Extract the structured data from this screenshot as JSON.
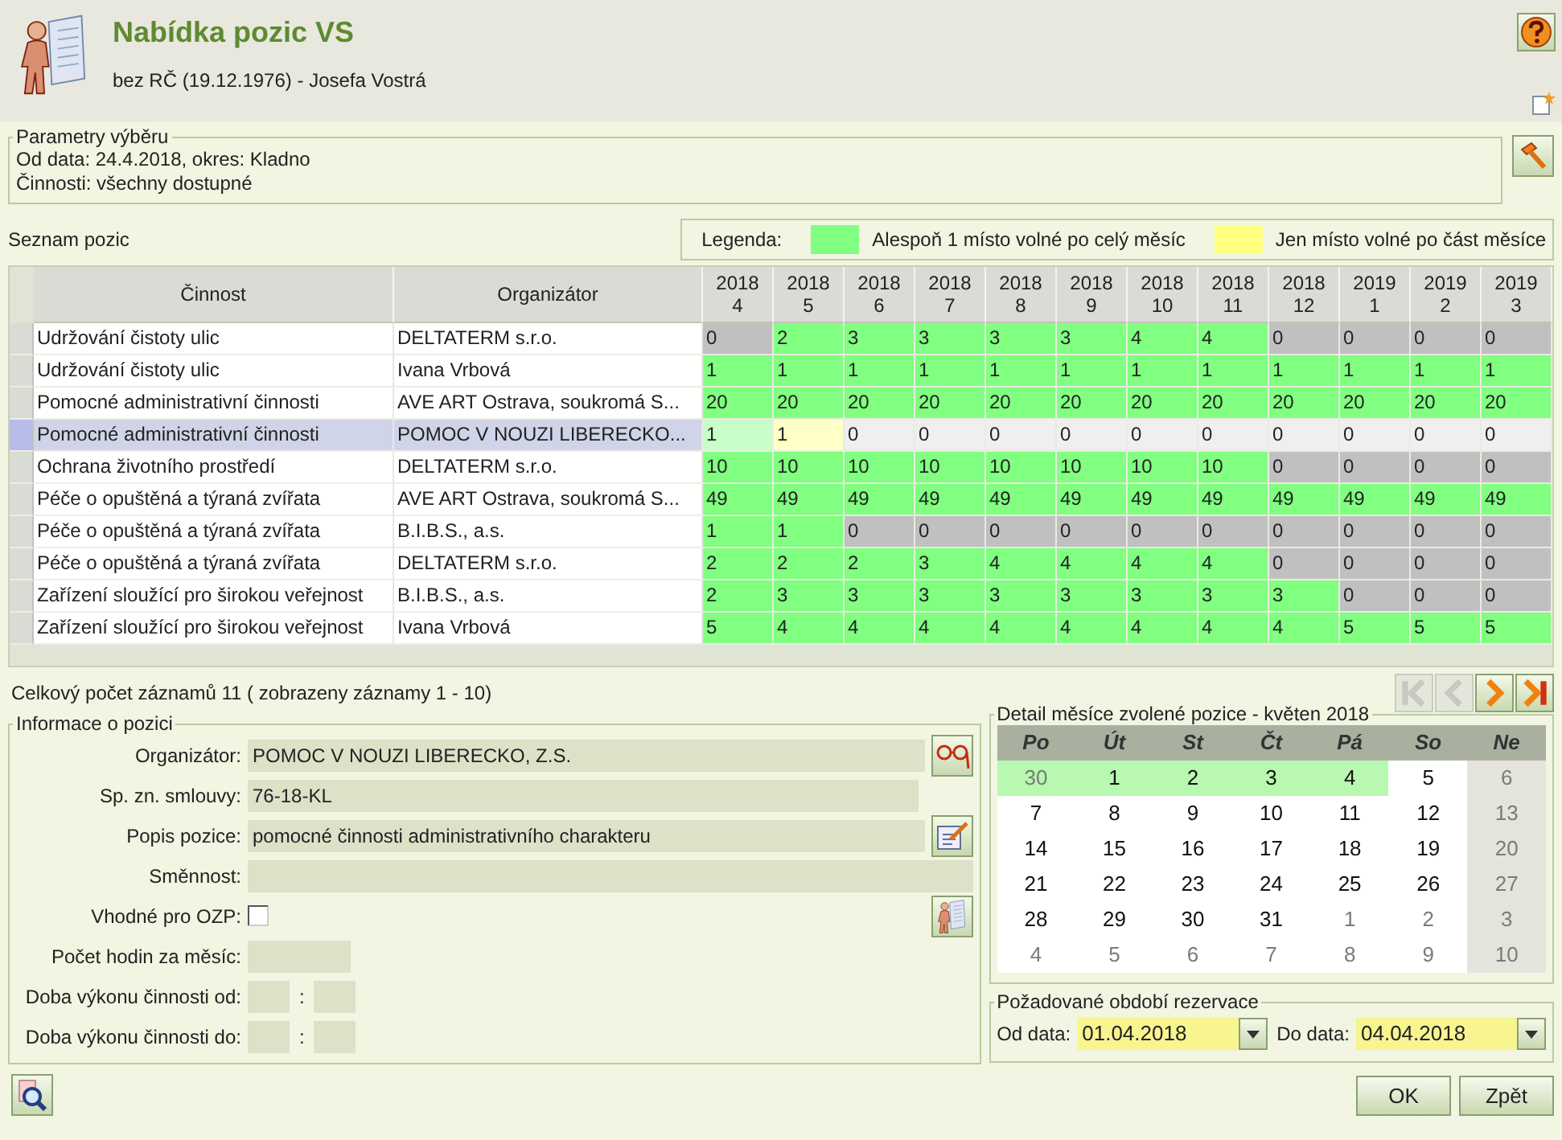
{
  "header": {
    "title": "Nabídka pozic VS",
    "subtitle": "bez RČ (19.12.1976) - Josefa Vostrá"
  },
  "parameters": {
    "legend": "Parametry výběru",
    "lines": [
      "Od data: 24.4.2018, okres: Kladno",
      "Činnosti: všechny dostupné"
    ]
  },
  "list_title": "Seznam pozic",
  "legend": {
    "label": "Legenda:",
    "items": [
      {
        "label": "Alespoň 1 místo volné po celý měsíc",
        "color": "#80ff80"
      },
      {
        "label": "Jen místo volné po část měsíce",
        "color": "#ffff80"
      }
    ]
  },
  "table": {
    "columns": [
      "Činnost",
      "Organizátor"
    ],
    "months": [
      [
        "2018",
        "4"
      ],
      [
        "2018",
        "5"
      ],
      [
        "2018",
        "6"
      ],
      [
        "2018",
        "7"
      ],
      [
        "2018",
        "8"
      ],
      [
        "2018",
        "9"
      ],
      [
        "2018",
        "10"
      ],
      [
        "2018",
        "11"
      ],
      [
        "2018",
        "12"
      ],
      [
        "2019",
        "1"
      ],
      [
        "2019",
        "2"
      ],
      [
        "2019",
        "3"
      ]
    ],
    "rows": [
      {
        "activity": "Udržování čistoty ulic",
        "organizer": "DELTATERM s.r.o.",
        "selected": false,
        "cells": [
          {
            "value": "0",
            "kind": "none"
          },
          {
            "value": "2",
            "kind": "full"
          },
          {
            "value": "3",
            "kind": "full"
          },
          {
            "value": "3",
            "kind": "full"
          },
          {
            "value": "3",
            "kind": "full"
          },
          {
            "value": "3",
            "kind": "full"
          },
          {
            "value": "4",
            "kind": "full"
          },
          {
            "value": "4",
            "kind": "full"
          },
          {
            "value": "0",
            "kind": "none"
          },
          {
            "value": "0",
            "kind": "none"
          },
          {
            "value": "0",
            "kind": "none"
          },
          {
            "value": "0",
            "kind": "none"
          }
        ]
      },
      {
        "activity": "Udržování čistoty ulic",
        "organizer": "Ivana Vrbová",
        "selected": false,
        "cells": [
          {
            "value": "1",
            "kind": "full"
          },
          {
            "value": "1",
            "kind": "full"
          },
          {
            "value": "1",
            "kind": "full"
          },
          {
            "value": "1",
            "kind": "full"
          },
          {
            "value": "1",
            "kind": "full"
          },
          {
            "value": "1",
            "kind": "full"
          },
          {
            "value": "1",
            "kind": "full"
          },
          {
            "value": "1",
            "kind": "full"
          },
          {
            "value": "1",
            "kind": "full"
          },
          {
            "value": "1",
            "kind": "full"
          },
          {
            "value": "1",
            "kind": "full"
          },
          {
            "value": "1",
            "kind": "full"
          }
        ]
      },
      {
        "activity": "Pomocné administrativní činnosti",
        "organizer": "AVE ART Ostrava, soukromá S...",
        "selected": false,
        "cells": [
          {
            "value": "20",
            "kind": "full"
          },
          {
            "value": "20",
            "kind": "full"
          },
          {
            "value": "20",
            "kind": "full"
          },
          {
            "value": "20",
            "kind": "full"
          },
          {
            "value": "20",
            "kind": "full"
          },
          {
            "value": "20",
            "kind": "full"
          },
          {
            "value": "20",
            "kind": "full"
          },
          {
            "value": "20",
            "kind": "full"
          },
          {
            "value": "20",
            "kind": "full"
          },
          {
            "value": "20",
            "kind": "full"
          },
          {
            "value": "20",
            "kind": "full"
          },
          {
            "value": "20",
            "kind": "full"
          }
        ]
      },
      {
        "activity": "Pomocné administrativní činnosti",
        "organizer": "POMOC V NOUZI LIBERECKO...",
        "selected": true,
        "cells": [
          {
            "value": "1",
            "kind": "full"
          },
          {
            "value": "1",
            "kind": "partial"
          },
          {
            "value": "0",
            "kind": "none"
          },
          {
            "value": "0",
            "kind": "none"
          },
          {
            "value": "0",
            "kind": "none"
          },
          {
            "value": "0",
            "kind": "none"
          },
          {
            "value": "0",
            "kind": "none"
          },
          {
            "value": "0",
            "kind": "none"
          },
          {
            "value": "0",
            "kind": "none"
          },
          {
            "value": "0",
            "kind": "none"
          },
          {
            "value": "0",
            "kind": "none"
          },
          {
            "value": "0",
            "kind": "none"
          }
        ]
      },
      {
        "activity": "Ochrana životního prostředí",
        "organizer": "DELTATERM s.r.o.",
        "selected": false,
        "cells": [
          {
            "value": "10",
            "kind": "full"
          },
          {
            "value": "10",
            "kind": "full"
          },
          {
            "value": "10",
            "kind": "full"
          },
          {
            "value": "10",
            "kind": "full"
          },
          {
            "value": "10",
            "kind": "full"
          },
          {
            "value": "10",
            "kind": "full"
          },
          {
            "value": "10",
            "kind": "full"
          },
          {
            "value": "10",
            "kind": "full"
          },
          {
            "value": "0",
            "kind": "none"
          },
          {
            "value": "0",
            "kind": "none"
          },
          {
            "value": "0",
            "kind": "none"
          },
          {
            "value": "0",
            "kind": "none"
          }
        ]
      },
      {
        "activity": "Péče o opuštěná a týraná zvířata",
        "organizer": "AVE ART Ostrava, soukromá S...",
        "selected": false,
        "cells": [
          {
            "value": "49",
            "kind": "full"
          },
          {
            "value": "49",
            "kind": "full"
          },
          {
            "value": "49",
            "kind": "full"
          },
          {
            "value": "49",
            "kind": "full"
          },
          {
            "value": "49",
            "kind": "full"
          },
          {
            "value": "49",
            "kind": "full"
          },
          {
            "value": "49",
            "kind": "full"
          },
          {
            "value": "49",
            "kind": "full"
          },
          {
            "value": "49",
            "kind": "full"
          },
          {
            "value": "49",
            "kind": "full"
          },
          {
            "value": "49",
            "kind": "full"
          },
          {
            "value": "49",
            "kind": "full"
          }
        ]
      },
      {
        "activity": "Péče o opuštěná a týraná zvířata",
        "organizer": "B.I.B.S., a.s.",
        "selected": false,
        "cells": [
          {
            "value": "1",
            "kind": "full"
          },
          {
            "value": "1",
            "kind": "full"
          },
          {
            "value": "0",
            "kind": "none"
          },
          {
            "value": "0",
            "kind": "none"
          },
          {
            "value": "0",
            "kind": "none"
          },
          {
            "value": "0",
            "kind": "none"
          },
          {
            "value": "0",
            "kind": "none"
          },
          {
            "value": "0",
            "kind": "none"
          },
          {
            "value": "0",
            "kind": "none"
          },
          {
            "value": "0",
            "kind": "none"
          },
          {
            "value": "0",
            "kind": "none"
          },
          {
            "value": "0",
            "kind": "none"
          }
        ]
      },
      {
        "activity": "Péče o opuštěná a týraná zvířata",
        "organizer": "DELTATERM s.r.o.",
        "selected": false,
        "cells": [
          {
            "value": "2",
            "kind": "full"
          },
          {
            "value": "2",
            "kind": "full"
          },
          {
            "value": "2",
            "kind": "full"
          },
          {
            "value": "3",
            "kind": "full"
          },
          {
            "value": "4",
            "kind": "full"
          },
          {
            "value": "4",
            "kind": "full"
          },
          {
            "value": "4",
            "kind": "full"
          },
          {
            "value": "4",
            "kind": "full"
          },
          {
            "value": "0",
            "kind": "none"
          },
          {
            "value": "0",
            "kind": "none"
          },
          {
            "value": "0",
            "kind": "none"
          },
          {
            "value": "0",
            "kind": "none"
          }
        ]
      },
      {
        "activity": "Zařízení sloužící pro širokou veřejnost",
        "organizer": "B.I.B.S., a.s.",
        "selected": false,
        "cells": [
          {
            "value": "2",
            "kind": "full"
          },
          {
            "value": "3",
            "kind": "full"
          },
          {
            "value": "3",
            "kind": "full"
          },
          {
            "value": "3",
            "kind": "full"
          },
          {
            "value": "3",
            "kind": "full"
          },
          {
            "value": "3",
            "kind": "full"
          },
          {
            "value": "3",
            "kind": "full"
          },
          {
            "value": "3",
            "kind": "full"
          },
          {
            "value": "3",
            "kind": "full"
          },
          {
            "value": "0",
            "kind": "none"
          },
          {
            "value": "0",
            "kind": "none"
          },
          {
            "value": "0",
            "kind": "none"
          }
        ]
      },
      {
        "activity": "Zařízení sloužící pro širokou veřejnost",
        "organizer": "Ivana Vrbová",
        "selected": false,
        "cells": [
          {
            "value": "5",
            "kind": "full"
          },
          {
            "value": "4",
            "kind": "full"
          },
          {
            "value": "4",
            "kind": "full"
          },
          {
            "value": "4",
            "kind": "full"
          },
          {
            "value": "4",
            "kind": "full"
          },
          {
            "value": "4",
            "kind": "full"
          },
          {
            "value": "4",
            "kind": "full"
          },
          {
            "value": "4",
            "kind": "full"
          },
          {
            "value": "4",
            "kind": "full"
          },
          {
            "value": "5",
            "kind": "full"
          },
          {
            "value": "5",
            "kind": "full"
          },
          {
            "value": "5",
            "kind": "full"
          }
        ]
      }
    ]
  },
  "record_count": "Celkový počet záznamů 11 ( zobrazeny záznamy 1 - 10)",
  "pager": [
    {
      "kind": "first",
      "disabled": true
    },
    {
      "kind": "prev",
      "disabled": true
    },
    {
      "kind": "next",
      "disabled": false
    },
    {
      "kind": "last",
      "disabled": false
    }
  ],
  "info": {
    "legend": "Informace o pozici",
    "fields": [
      {
        "label": "Organizátor:",
        "value": "POMOC V NOUZI LIBERECKO, Z.S.",
        "kind": "text",
        "button": {
          "kind": "glasses"
        }
      },
      {
        "label": "Sp. zn. smlouvy:",
        "value": "76-18-KL",
        "kind": "text"
      },
      {
        "label": "Popis pozice:",
        "value": "pomocné činnosti administrativního charakteru",
        "kind": "text",
        "button": {
          "kind": "edit"
        }
      },
      {
        "label": "Směnnost:",
        "kind": "wide"
      },
      {
        "label": "Vhodné pro OZP:",
        "kind": "checkbox",
        "checked": false,
        "button": {
          "kind": "person"
        }
      },
      {
        "label": "Počet hodin za měsíc:",
        "kind": "short"
      },
      {
        "label": "Doba výkonu činnosti od:",
        "kind": "time",
        "separator": ":"
      },
      {
        "label": "Doba výkonu činnosti do:",
        "kind": "time",
        "separator": ":"
      }
    ]
  },
  "calendar": {
    "legend": "Detail měsíce zvolené pozice - květen 2018",
    "weekdays": [
      "Po",
      "Út",
      "St",
      "Čt",
      "Pá",
      "So",
      "Ne"
    ],
    "weeks": [
      [
        {
          "day": "30",
          "outside": true,
          "available": true
        },
        {
          "day": "1",
          "outside": false,
          "available": true
        },
        {
          "day": "2",
          "outside": false,
          "available": true
        },
        {
          "day": "3",
          "outside": false,
          "available": true
        },
        {
          "day": "4",
          "outside": false,
          "available": true
        },
        {
          "day": "5",
          "outside": false,
          "available": false
        },
        {
          "day": "6",
          "outside": true,
          "available": false
        }
      ],
      [
        {
          "day": "7",
          "outside": false,
          "available": false
        },
        {
          "day": "8",
          "outside": false,
          "available": false
        },
        {
          "day": "9",
          "outside": false,
          "available": false
        },
        {
          "day": "10",
          "outside": false,
          "available": false
        },
        {
          "day": "11",
          "outside": false,
          "available": false
        },
        {
          "day": "12",
          "outside": false,
          "available": false
        },
        {
          "day": "13",
          "outside": true,
          "available": false
        }
      ],
      [
        {
          "day": "14",
          "outside": false,
          "available": false
        },
        {
          "day": "15",
          "outside": false,
          "available": false
        },
        {
          "day": "16",
          "outside": false,
          "available": false
        },
        {
          "day": "17",
          "outside": false,
          "available": false
        },
        {
          "day": "18",
          "outside": false,
          "available": false
        },
        {
          "day": "19",
          "outside": false,
          "available": false
        },
        {
          "day": "20",
          "outside": true,
          "available": false
        }
      ],
      [
        {
          "day": "21",
          "outside": false,
          "available": false
        },
        {
          "day": "22",
          "outside": false,
          "available": false
        },
        {
          "day": "23",
          "outside": false,
          "available": false
        },
        {
          "day": "24",
          "outside": false,
          "available": false
        },
        {
          "day": "25",
          "outside": false,
          "available": false
        },
        {
          "day": "26",
          "outside": false,
          "available": false
        },
        {
          "day": "27",
          "outside": true,
          "available": false
        }
      ],
      [
        {
          "day": "28",
          "outside": false,
          "available": false
        },
        {
          "day": "29",
          "outside": false,
          "available": false
        },
        {
          "day": "30",
          "outside": false,
          "available": false
        },
        {
          "day": "31",
          "outside": false,
          "available": false
        },
        {
          "day": "1",
          "outside": true,
          "available": false
        },
        {
          "day": "2",
          "outside": true,
          "available": false
        },
        {
          "day": "3",
          "outside": true,
          "available": false
        }
      ],
      [
        {
          "day": "4",
          "outside": true,
          "available": false
        },
        {
          "day": "5",
          "outside": true,
          "available": false
        },
        {
          "day": "6",
          "outside": true,
          "available": false
        },
        {
          "day": "7",
          "outside": true,
          "available": false
        },
        {
          "day": "8",
          "outside": true,
          "available": false
        },
        {
          "day": "9",
          "outside": true,
          "available": false
        },
        {
          "day": "10",
          "outside": true,
          "available": false
        }
      ]
    ]
  },
  "period": {
    "legend": "Požadované období rezervace",
    "from_label": "Od data:",
    "from": "01.04.2018",
    "to_label": "Do data:",
    "to": "04.04.2018"
  },
  "buttons": [
    "OK",
    "Zpět"
  ]
}
